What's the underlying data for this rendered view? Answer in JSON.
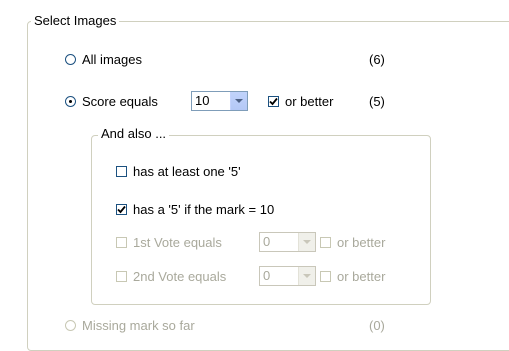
{
  "group": {
    "legend": "Select Images"
  },
  "options": {
    "all": {
      "label": "All images",
      "count": "(6)"
    },
    "score": {
      "label": "Score equals",
      "value": "10",
      "or_better_label": "or better",
      "count": "(5)"
    },
    "missing": {
      "label": "Missing mark so far",
      "count": "(0)"
    }
  },
  "and_also": {
    "legend": "And also ...",
    "has_five": {
      "label": "has at least one '5'"
    },
    "has_five_if_ten": {
      "label": "has a '5' if the mark = 10"
    },
    "first_vote": {
      "label": "1st Vote equals",
      "value": "0",
      "or_better_label": "or better"
    },
    "second_vote": {
      "label": "2nd Vote equals",
      "value": "0",
      "or_better_label": "or better"
    }
  },
  "icons": {
    "check": "checkmark-icon",
    "dropdown": "chevron-down-icon"
  }
}
